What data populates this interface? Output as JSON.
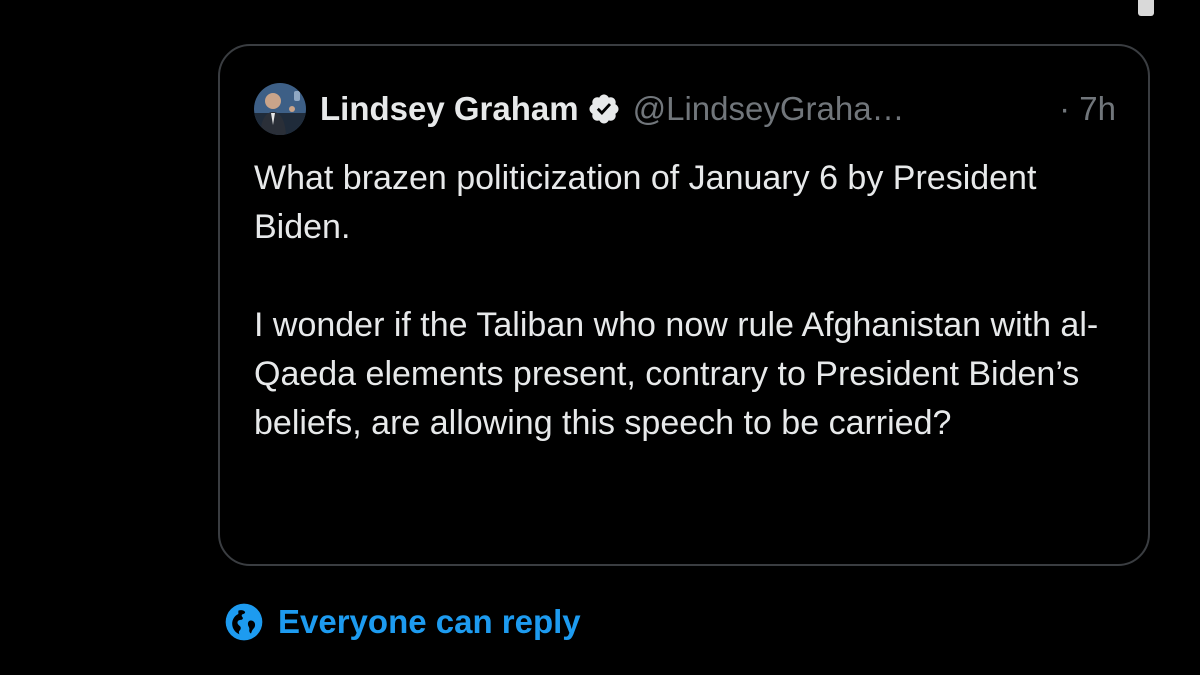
{
  "colors": {
    "background": "#000000",
    "text_primary": "#e7e9ea",
    "text_secondary": "#71767b",
    "accent": "#1d9bf0",
    "card_border": "#3a3d41"
  },
  "quote_tweet": {
    "author": {
      "display_name": "Lindsey Graham",
      "handle": "@LindseyGraha…",
      "verified": true,
      "avatar_icon": "profile-photo"
    },
    "time": "· 7h",
    "paragraphs": [
      "What brazen politicization of January 6 by President Biden.",
      "I wonder if the Taliban who now rule Afghanistan with al-Qaeda elements present, contrary to President Biden’s beliefs, are allowing this speech to be carried?"
    ]
  },
  "reply_setting": {
    "icon": "globe-icon",
    "label": "Everyone can reply"
  }
}
